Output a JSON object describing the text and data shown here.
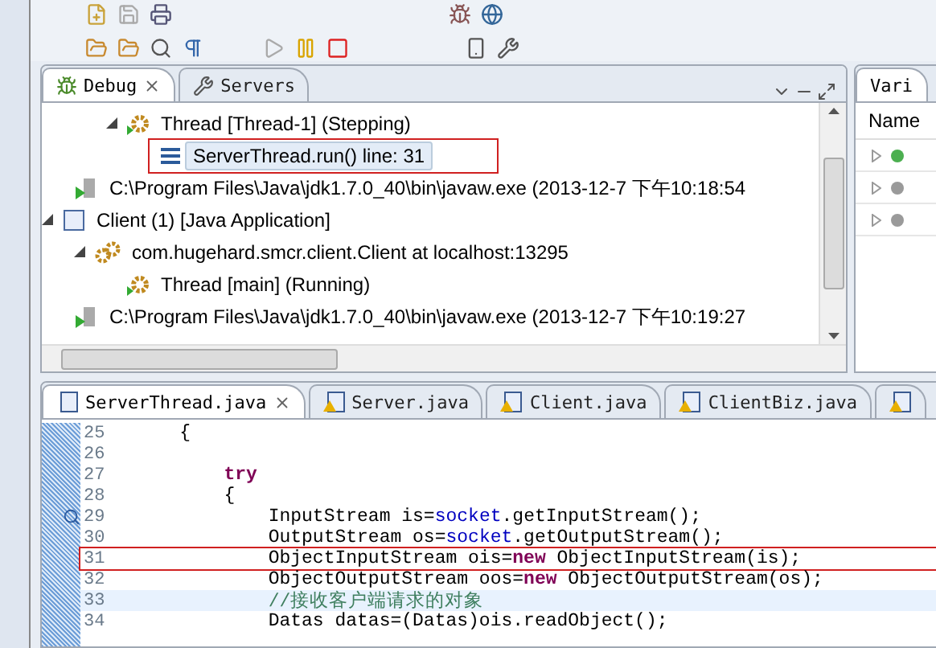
{
  "debug_view": {
    "tabs": [
      {
        "label": "Debug",
        "selected": true,
        "closable": true
      },
      {
        "label": "Servers",
        "selected": false,
        "closable": false
      }
    ],
    "tree": [
      {
        "children": [
          {
            "children": [
              {
                "label": "Thread [Thread-1] (Stepping)",
                "kind": "thread",
                "expanded": true,
                "children": [
                  {
                    "label": "ServerThread.run() line: 31",
                    "kind": "frame",
                    "selected": true,
                    "marked": true
                  }
                ]
              }
            ]
          },
          {
            "label": "C:\\Program Files\\Java\\jdk1.7.0_40\\bin\\javaw.exe (2013-12-7 下午10:18:54",
            "kind": "process"
          }
        ]
      },
      {
        "label": "Client (1) [Java Application]",
        "kind": "launch",
        "expanded": true,
        "children": [
          {
            "label": "com.hugehard.smcr.client.Client at localhost:13295",
            "kind": "target",
            "expanded": true,
            "children": [
              {
                "label": "Thread [main] (Running)",
                "kind": "thread"
              }
            ]
          },
          {
            "label": "C:\\Program Files\\Java\\jdk1.7.0_40\\bin\\javaw.exe (2013-12-7 下午10:19:27",
            "kind": "process"
          }
        ]
      }
    ]
  },
  "variables_view": {
    "tab": "Vari",
    "column": "Name",
    "rows": [
      {
        "color": "#4caf50"
      },
      {
        "color": "#9a9a9a"
      },
      {
        "color": "#9a9a9a"
      }
    ]
  },
  "editor": {
    "tabs": [
      {
        "label": "ServerThread.java",
        "selected": true,
        "closable": true,
        "warning": false
      },
      {
        "label": "Server.java",
        "selected": false,
        "closable": false,
        "warning": true
      },
      {
        "label": "Client.java",
        "selected": false,
        "closable": false,
        "warning": true
      },
      {
        "label": "ClientBiz.java",
        "selected": false,
        "closable": false,
        "warning": true
      },
      {
        "selected": false,
        "closable": false,
        "warning": true
      }
    ],
    "lines": [
      {
        "number": "25",
        "tokens": [
          {
            "kind": "plain",
            "text": "    {"
          }
        ]
      },
      {
        "number": "26"
      },
      {
        "number": "27",
        "tokens": [
          {
            "kind": "keyword",
            "text": "        try"
          }
        ]
      },
      {
        "number": "28",
        "tokens": [
          {
            "kind": "plain",
            "text": "        {"
          }
        ]
      },
      {
        "number": "29",
        "breakpoint": true,
        "tokens": [
          {
            "kind": "plain",
            "text": "            InputStream is="
          },
          {
            "kind": "field",
            "text": "socket"
          },
          {
            "kind": "plain",
            "text": ".getInputStream();"
          }
        ]
      },
      {
        "number": "30",
        "tokens": [
          {
            "kind": "plain",
            "text": "            OutputStream os="
          },
          {
            "kind": "field",
            "text": "socket"
          },
          {
            "kind": "plain",
            "text": ".getOutputStream();"
          }
        ]
      },
      {
        "number": "31",
        "marked": true,
        "tokens": [
          {
            "kind": "plain",
            "text": "            ObjectInputStream ois="
          },
          {
            "kind": "keyword",
            "text": "new"
          },
          {
            "kind": "plain",
            "text": " ObjectInputStream(is);"
          }
        ]
      },
      {
        "number": "32",
        "tokens": [
          {
            "kind": "plain",
            "text": "            ObjectOutputStream oos="
          },
          {
            "kind": "keyword",
            "text": "new"
          },
          {
            "kind": "plain",
            "text": " ObjectOutputStream(os);"
          }
        ]
      },
      {
        "number": "33",
        "current": true,
        "tokens": [
          {
            "kind": "comment",
            "text": "            //接收客户端请求的对象"
          }
        ]
      },
      {
        "number": "34",
        "tokens": [
          {
            "kind": "plain",
            "text": "            Datas datas=(Datas)ois.readObject();"
          }
        ]
      }
    ]
  }
}
